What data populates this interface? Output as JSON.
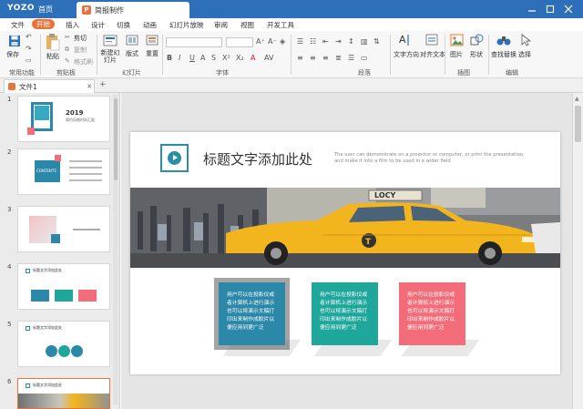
{
  "titlebar": {
    "logo": "YOZO",
    "home_tab": "首页",
    "doc_tab": "简报制作",
    "doc_icon": "P"
  },
  "menu": [
    "文件",
    "开始",
    "插入",
    "设计",
    "切换",
    "动画",
    "幻灯片放映",
    "审阅",
    "视图",
    "开发工具"
  ],
  "ribbon": {
    "save": "保存",
    "paste": "粘贴",
    "cut": "剪切",
    "copy": "复制",
    "format_painter": "格式刷",
    "new_slide": "新建幻灯片",
    "layout": "版式",
    "reset": "重置",
    "text_direction": "文字方向",
    "align_text": "对齐文本",
    "picture": "图片",
    "shape": "形状",
    "find_replace": "查找替换",
    "select": "选择",
    "groups": {
      "common": "常用功能",
      "clipboard": "剪贴板",
      "slides": "幻灯片",
      "font": "字体",
      "paragraph": "段落",
      "drawing": "插图",
      "editing": "编辑"
    }
  },
  "file_tab": {
    "label": "文件1"
  },
  "thumbnails": [
    {
      "number": "1",
      "year": "2019",
      "subtitle": "简约风格时尚汇报"
    },
    {
      "number": "2",
      "heading": "CONTENTS"
    },
    {
      "number": "3"
    },
    {
      "number": "4",
      "heading": "标题文字添加此处"
    },
    {
      "number": "5",
      "heading": "标题文字添加此处"
    },
    {
      "number": "6",
      "heading": "标题文字添加此处"
    }
  ],
  "slide": {
    "title": "标题文字添加此处",
    "description": "The user can demonstrate on a projector or computer, or print the presentation and make it into a film to be used in a wider field",
    "taxi_sign": "LOCY",
    "cards": [
      "用户可以在投影仪或者计算机上进行演示也可以将演示文稿打印出来制作成胶片以便应用到更广泛",
      "用户可以在投影仪或者计算机上进行演示也可以将演示文稿打印出来制作成胶片以便应用到更广泛",
      "用户可以在投影仪或者计算机上进行演示也可以将演示文稿打印出来制作成胶片以便应用到更广泛"
    ]
  },
  "colors": {
    "titlebar": "#2d6fb8",
    "accent": "#e8743b",
    "teal": "#2b8ea8",
    "green": "#1fa79b",
    "pink": "#f36c7a",
    "taxi": "#f3b51d"
  }
}
